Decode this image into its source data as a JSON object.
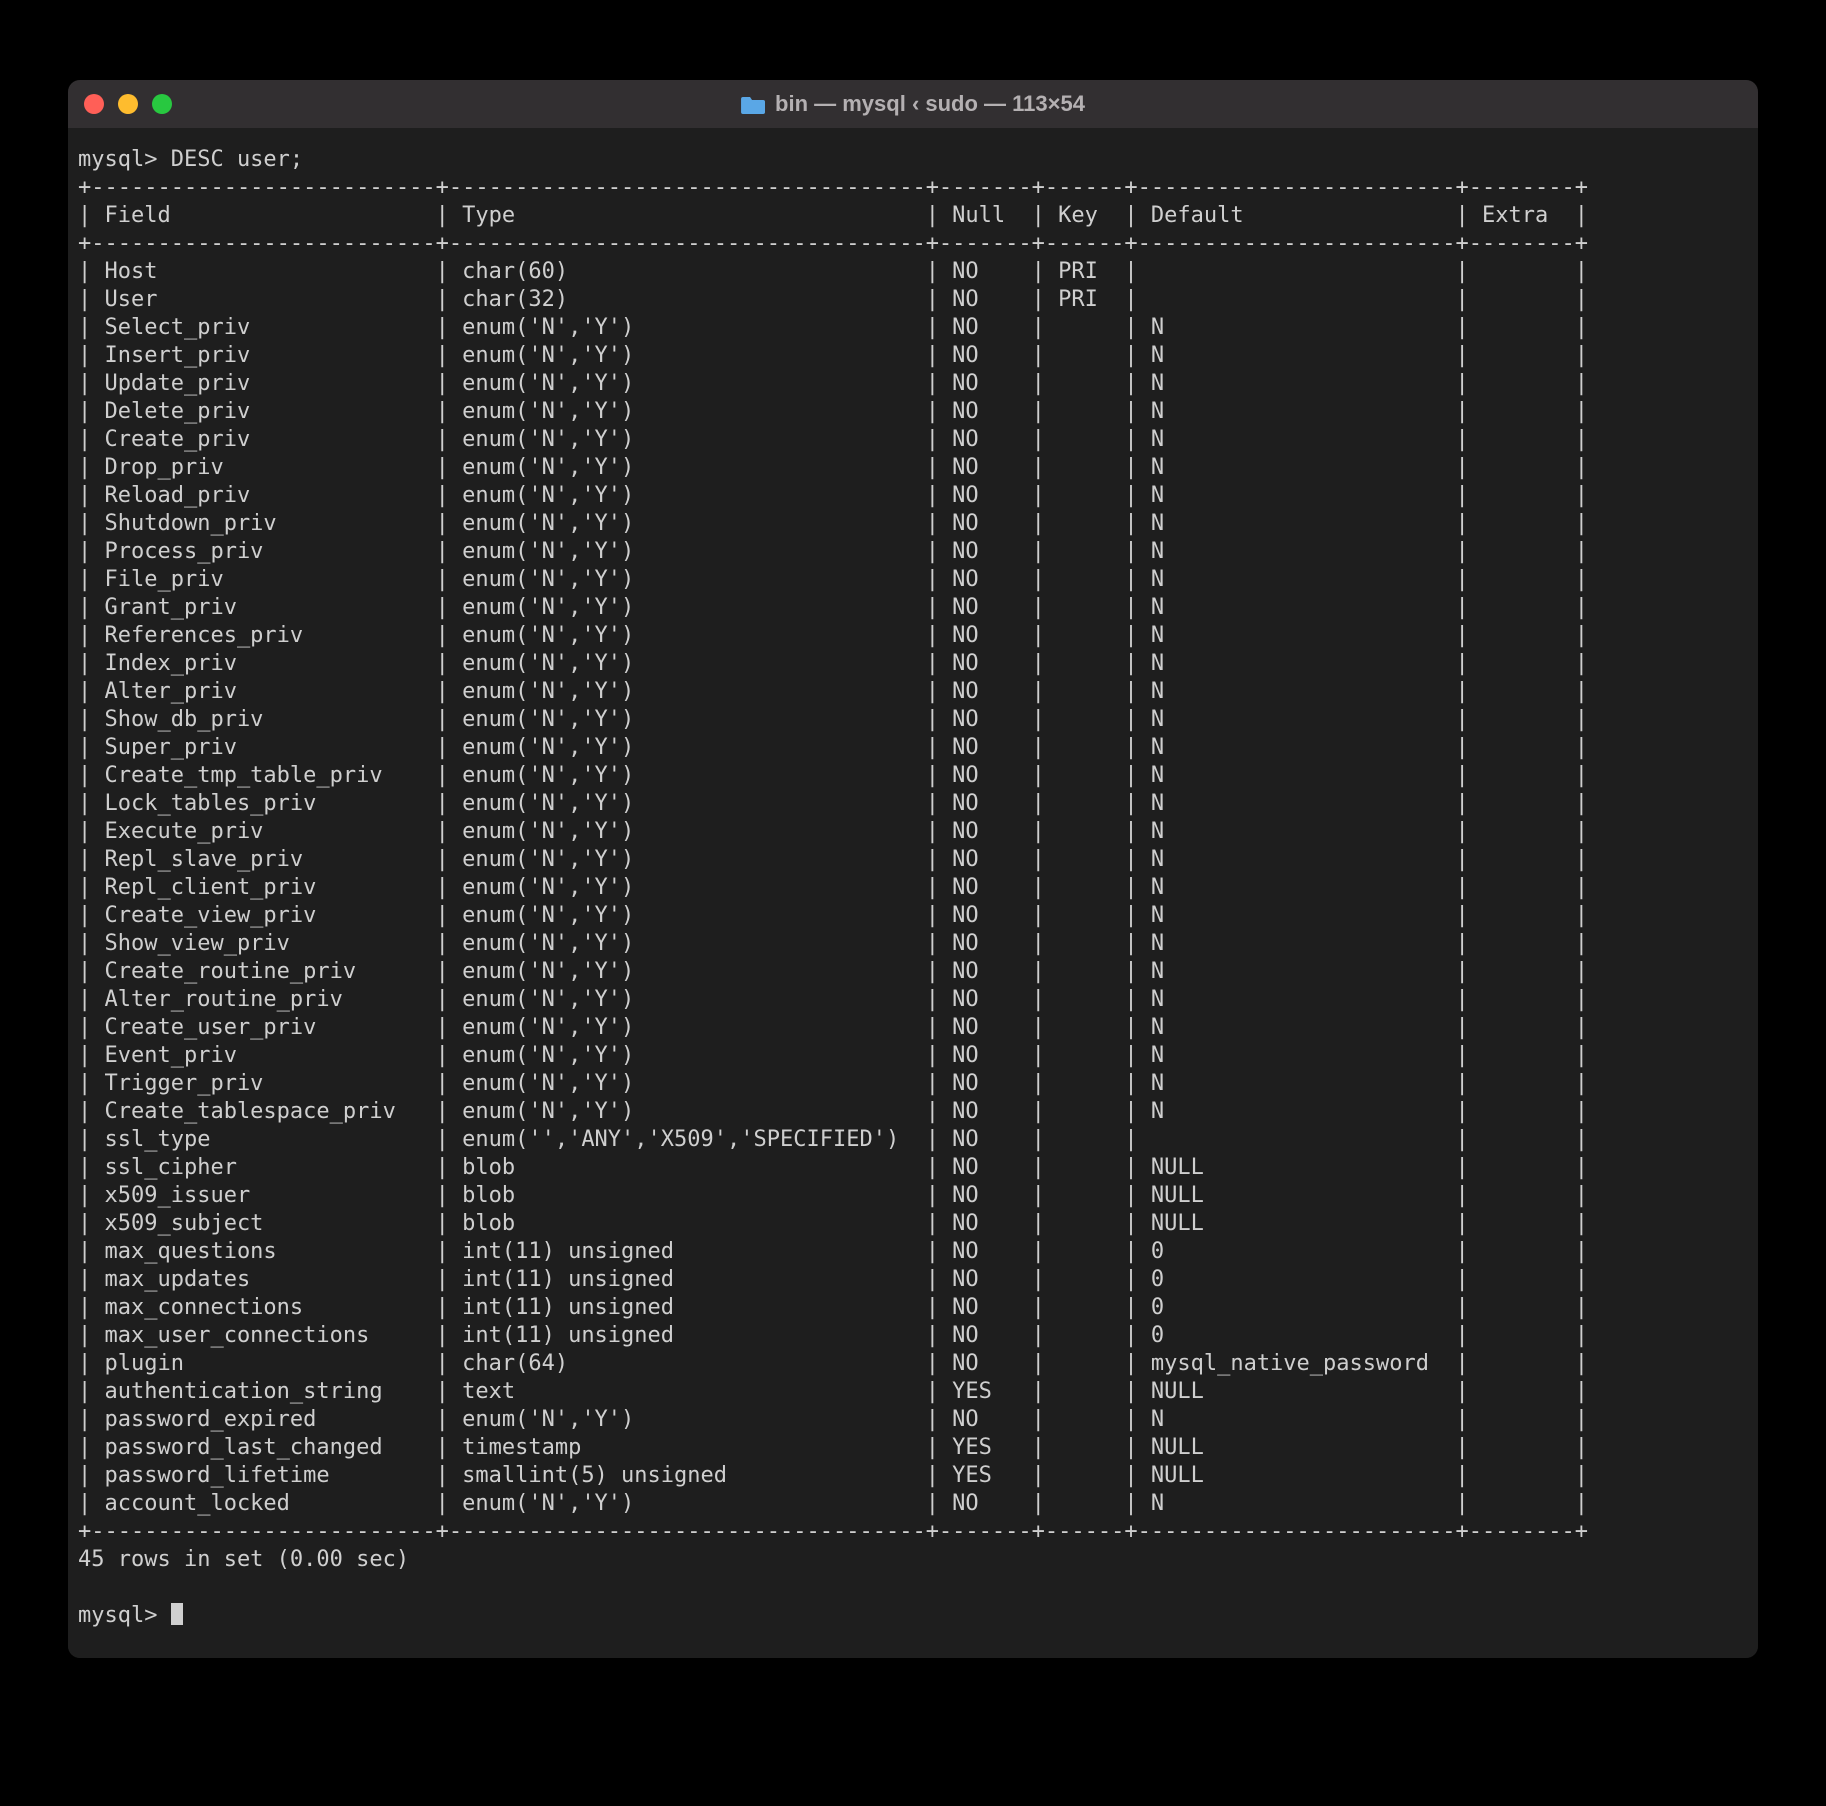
{
  "window": {
    "title": "bin — mysql ‹ sudo — 113×54"
  },
  "prompt1": "mysql> ",
  "command": "DESC user;",
  "table": {
    "headers": [
      "Field",
      "Type",
      "Null",
      "Key",
      "Default",
      "Extra"
    ],
    "rows": [
      {
        "field": "Host",
        "type": "char(60)",
        "null": "NO",
        "key": "PRI",
        "default": "",
        "extra": ""
      },
      {
        "field": "User",
        "type": "char(32)",
        "null": "NO",
        "key": "PRI",
        "default": "",
        "extra": ""
      },
      {
        "field": "Select_priv",
        "type": "enum('N','Y')",
        "null": "NO",
        "key": "",
        "default": "N",
        "extra": ""
      },
      {
        "field": "Insert_priv",
        "type": "enum('N','Y')",
        "null": "NO",
        "key": "",
        "default": "N",
        "extra": ""
      },
      {
        "field": "Update_priv",
        "type": "enum('N','Y')",
        "null": "NO",
        "key": "",
        "default": "N",
        "extra": ""
      },
      {
        "field": "Delete_priv",
        "type": "enum('N','Y')",
        "null": "NO",
        "key": "",
        "default": "N",
        "extra": ""
      },
      {
        "field": "Create_priv",
        "type": "enum('N','Y')",
        "null": "NO",
        "key": "",
        "default": "N",
        "extra": ""
      },
      {
        "field": "Drop_priv",
        "type": "enum('N','Y')",
        "null": "NO",
        "key": "",
        "default": "N",
        "extra": ""
      },
      {
        "field": "Reload_priv",
        "type": "enum('N','Y')",
        "null": "NO",
        "key": "",
        "default": "N",
        "extra": ""
      },
      {
        "field": "Shutdown_priv",
        "type": "enum('N','Y')",
        "null": "NO",
        "key": "",
        "default": "N",
        "extra": ""
      },
      {
        "field": "Process_priv",
        "type": "enum('N','Y')",
        "null": "NO",
        "key": "",
        "default": "N",
        "extra": ""
      },
      {
        "field": "File_priv",
        "type": "enum('N','Y')",
        "null": "NO",
        "key": "",
        "default": "N",
        "extra": ""
      },
      {
        "field": "Grant_priv",
        "type": "enum('N','Y')",
        "null": "NO",
        "key": "",
        "default": "N",
        "extra": ""
      },
      {
        "field": "References_priv",
        "type": "enum('N','Y')",
        "null": "NO",
        "key": "",
        "default": "N",
        "extra": ""
      },
      {
        "field": "Index_priv",
        "type": "enum('N','Y')",
        "null": "NO",
        "key": "",
        "default": "N",
        "extra": ""
      },
      {
        "field": "Alter_priv",
        "type": "enum('N','Y')",
        "null": "NO",
        "key": "",
        "default": "N",
        "extra": ""
      },
      {
        "field": "Show_db_priv",
        "type": "enum('N','Y')",
        "null": "NO",
        "key": "",
        "default": "N",
        "extra": ""
      },
      {
        "field": "Super_priv",
        "type": "enum('N','Y')",
        "null": "NO",
        "key": "",
        "default": "N",
        "extra": ""
      },
      {
        "field": "Create_tmp_table_priv",
        "type": "enum('N','Y')",
        "null": "NO",
        "key": "",
        "default": "N",
        "extra": ""
      },
      {
        "field": "Lock_tables_priv",
        "type": "enum('N','Y')",
        "null": "NO",
        "key": "",
        "default": "N",
        "extra": ""
      },
      {
        "field": "Execute_priv",
        "type": "enum('N','Y')",
        "null": "NO",
        "key": "",
        "default": "N",
        "extra": ""
      },
      {
        "field": "Repl_slave_priv",
        "type": "enum('N','Y')",
        "null": "NO",
        "key": "",
        "default": "N",
        "extra": ""
      },
      {
        "field": "Repl_client_priv",
        "type": "enum('N','Y')",
        "null": "NO",
        "key": "",
        "default": "N",
        "extra": ""
      },
      {
        "field": "Create_view_priv",
        "type": "enum('N','Y')",
        "null": "NO",
        "key": "",
        "default": "N",
        "extra": ""
      },
      {
        "field": "Show_view_priv",
        "type": "enum('N','Y')",
        "null": "NO",
        "key": "",
        "default": "N",
        "extra": ""
      },
      {
        "field": "Create_routine_priv",
        "type": "enum('N','Y')",
        "null": "NO",
        "key": "",
        "default": "N",
        "extra": ""
      },
      {
        "field": "Alter_routine_priv",
        "type": "enum('N','Y')",
        "null": "NO",
        "key": "",
        "default": "N",
        "extra": ""
      },
      {
        "field": "Create_user_priv",
        "type": "enum('N','Y')",
        "null": "NO",
        "key": "",
        "default": "N",
        "extra": ""
      },
      {
        "field": "Event_priv",
        "type": "enum('N','Y')",
        "null": "NO",
        "key": "",
        "default": "N",
        "extra": ""
      },
      {
        "field": "Trigger_priv",
        "type": "enum('N','Y')",
        "null": "NO",
        "key": "",
        "default": "N",
        "extra": ""
      },
      {
        "field": "Create_tablespace_priv",
        "type": "enum('N','Y')",
        "null": "NO",
        "key": "",
        "default": "N",
        "extra": ""
      },
      {
        "field": "ssl_type",
        "type": "enum('','ANY','X509','SPECIFIED')",
        "null": "NO",
        "key": "",
        "default": "",
        "extra": ""
      },
      {
        "field": "ssl_cipher",
        "type": "blob",
        "null": "NO",
        "key": "",
        "default": "NULL",
        "extra": ""
      },
      {
        "field": "x509_issuer",
        "type": "blob",
        "null": "NO",
        "key": "",
        "default": "NULL",
        "extra": ""
      },
      {
        "field": "x509_subject",
        "type": "blob",
        "null": "NO",
        "key": "",
        "default": "NULL",
        "extra": ""
      },
      {
        "field": "max_questions",
        "type": "int(11) unsigned",
        "null": "NO",
        "key": "",
        "default": "0",
        "extra": ""
      },
      {
        "field": "max_updates",
        "type": "int(11) unsigned",
        "null": "NO",
        "key": "",
        "default": "0",
        "extra": ""
      },
      {
        "field": "max_connections",
        "type": "int(11) unsigned",
        "null": "NO",
        "key": "",
        "default": "0",
        "extra": ""
      },
      {
        "field": "max_user_connections",
        "type": "int(11) unsigned",
        "null": "NO",
        "key": "",
        "default": "0",
        "extra": ""
      },
      {
        "field": "plugin",
        "type": "char(64)",
        "null": "NO",
        "key": "",
        "default": "mysql_native_password",
        "extra": ""
      },
      {
        "field": "authentication_string",
        "type": "text",
        "null": "YES",
        "key": "",
        "default": "NULL",
        "extra": ""
      },
      {
        "field": "password_expired",
        "type": "enum('N','Y')",
        "null": "NO",
        "key": "",
        "default": "N",
        "extra": ""
      },
      {
        "field": "password_last_changed",
        "type": "timestamp",
        "null": "YES",
        "key": "",
        "default": "NULL",
        "extra": ""
      },
      {
        "field": "password_lifetime",
        "type": "smallint(5) unsigned",
        "null": "YES",
        "key": "",
        "default": "NULL",
        "extra": ""
      },
      {
        "field": "account_locked",
        "type": "enum('N','Y')",
        "null": "NO",
        "key": "",
        "default": "N",
        "extra": ""
      }
    ]
  },
  "footer": "45 rows in set (0.00 sec)",
  "prompt2": "mysql> "
}
